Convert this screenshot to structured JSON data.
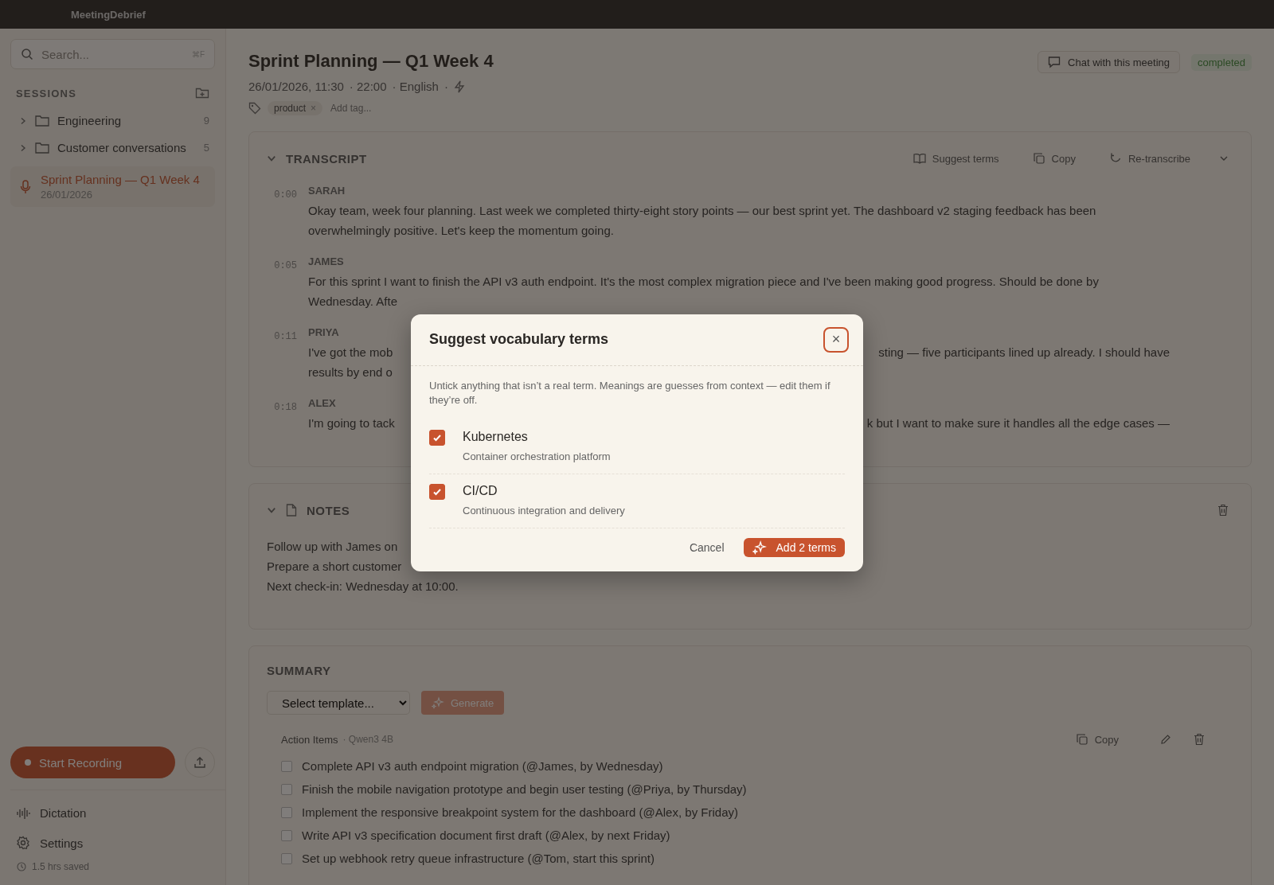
{
  "app": {
    "title": "MeetingDebrief"
  },
  "sidebar": {
    "search": {
      "placeholder": "Search...",
      "shortcut": "⌘F"
    },
    "sessions_heading": "SESSIONS",
    "folders": [
      {
        "name": "Engineering",
        "count": "9",
        "expanded": false
      },
      {
        "name": "Customer conversations",
        "count": "5",
        "expanded": false
      }
    ],
    "sessions": [
      {
        "title": "Sprint Planning — Q1 Week 4",
        "date": "26/01/2026",
        "selected": true
      }
    ],
    "record_button": "Start Recording",
    "nav": [
      {
        "label": "Dictation",
        "kind": "dictation"
      },
      {
        "label": "Settings",
        "kind": "settings"
      }
    ],
    "time_saved": "1.5 hrs saved"
  },
  "meeting": {
    "title": "Sprint Planning — Q1 Week 4",
    "meta": [
      "26/01/2026, 11:30",
      "· 22:00",
      "· English",
      "·"
    ],
    "chat_button": "Chat with this meeting",
    "status": "completed",
    "tags": [
      {
        "label": "product",
        "remove": "×"
      }
    ],
    "tag_input": {
      "placeholder": "Add tag..."
    }
  },
  "transcript": {
    "heading": "TRANSCRIPT",
    "expanded": true,
    "actions": [
      {
        "label": "Suggest terms",
        "kind": "book"
      },
      {
        "label": "Copy",
        "kind": "copy"
      },
      {
        "label": "Re-transcribe",
        "kind": "refresh"
      }
    ],
    "entries": [
      {
        "time": "0:00",
        "speaker": "SARAH",
        "lines": [
          {
            "left": "Okay team, week four planning. Last week we completed thirty-eight story points — our best sprint yet. The dashboard v2 staging feedback has been"
          },
          {
            "left": "overwhelmingly positive. Let's keep the momentum going."
          }
        ]
      },
      {
        "time": "0:05",
        "speaker": "JAMES",
        "lines": [
          {
            "left": "For this sprint I want to finish the API v3 auth endpoint. It's the most complex migration piece and I've been making good progress. Should be done by"
          },
          {
            "left": "Wednesday. Afte"
          }
        ]
      },
      {
        "time": "0:11",
        "speaker": "PRIYA",
        "lines": [
          {
            "left": "I've got the mob",
            "right": "sting — five participants lined up already. I should have"
          },
          {
            "left": "results by end o"
          }
        ]
      },
      {
        "time": "0:18",
        "speaker": "ALEX",
        "lines": [
          {
            "left": "I'm going to tack",
            "right": "k but I want to make sure it handles all the edge cases —"
          }
        ]
      }
    ]
  },
  "notes": {
    "heading": "NOTES",
    "expanded": true,
    "lines": [
      "Follow up with James on",
      "Prepare a short customer",
      "Next check-in: Wednesday at 10:00."
    ]
  },
  "summary": {
    "heading": "SUMMARY",
    "template_select": "Select template...",
    "generate_button": "Generate",
    "section_title": "Action Items",
    "model": "· Qwen3 4B",
    "copy_button": "Copy",
    "action_items": [
      {
        "text": "Complete API v3 auth endpoint migration (@James, by Wednesday)",
        "checked": false
      },
      {
        "text": "Finish the mobile navigation prototype and begin user testing (@Priya, by Thursday)",
        "checked": false
      },
      {
        "text": "Implement the responsive breakpoint system for the dashboard (@Alex, by Friday)",
        "checked": false
      },
      {
        "text": "Write API v3 specification document first draft (@Alex, by next Friday)",
        "checked": false
      },
      {
        "text": "Set up webhook retry queue infrastructure (@Tom, start this sprint)",
        "checked": false
      }
    ]
  },
  "dialog": {
    "title": "Suggest vocabulary terms",
    "close": "×",
    "description": "Untick anything that isn’t a real term. Meanings are guesses from context — edit them if they’re off.",
    "terms": [
      {
        "term": "Kubernetes",
        "meaning": "Container orchestration platform",
        "checked": true
      },
      {
        "term": "CI/CD",
        "meaning": "Continuous integration and delivery",
        "checked": true
      }
    ],
    "cancel_button": "Cancel",
    "confirm_button": "Add 2 terms"
  }
}
